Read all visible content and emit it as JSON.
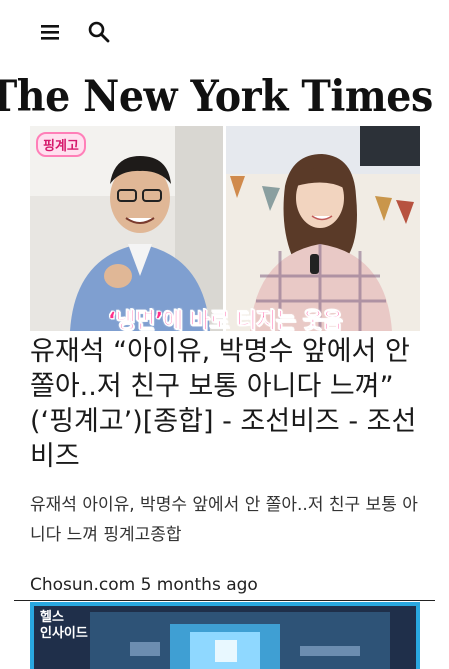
{
  "toolbar": {
    "menu_icon": "hamburger-menu-icon",
    "search_icon": "search-icon"
  },
  "brand": {
    "logo_text": "The New York Times"
  },
  "article": {
    "image_caption": "‘냉면’에 바로 터지는 웃음",
    "show_logo": "핑계고",
    "headline": "유재석 “아이유, 박명수 앞에서 안 쫄아..저 친구 보통 아니다 느껴” (‘핑계고’)[종합] - 조선비즈 - 조선비즈",
    "summary": "유재석 아이유, 박명수 앞에서 안 쫄아..저 친구 보통 아니다 느껴 핑계고종합",
    "meta": "Chosun.com 5 months ago"
  },
  "next_article": {
    "thumb_label_line1": "헬스",
    "thumb_label_line2": "인사이드"
  },
  "colors": {
    "accent_pink": "#ff2e8a",
    "text": "#1a1a1a",
    "thumb_border": "#29a8e0"
  }
}
